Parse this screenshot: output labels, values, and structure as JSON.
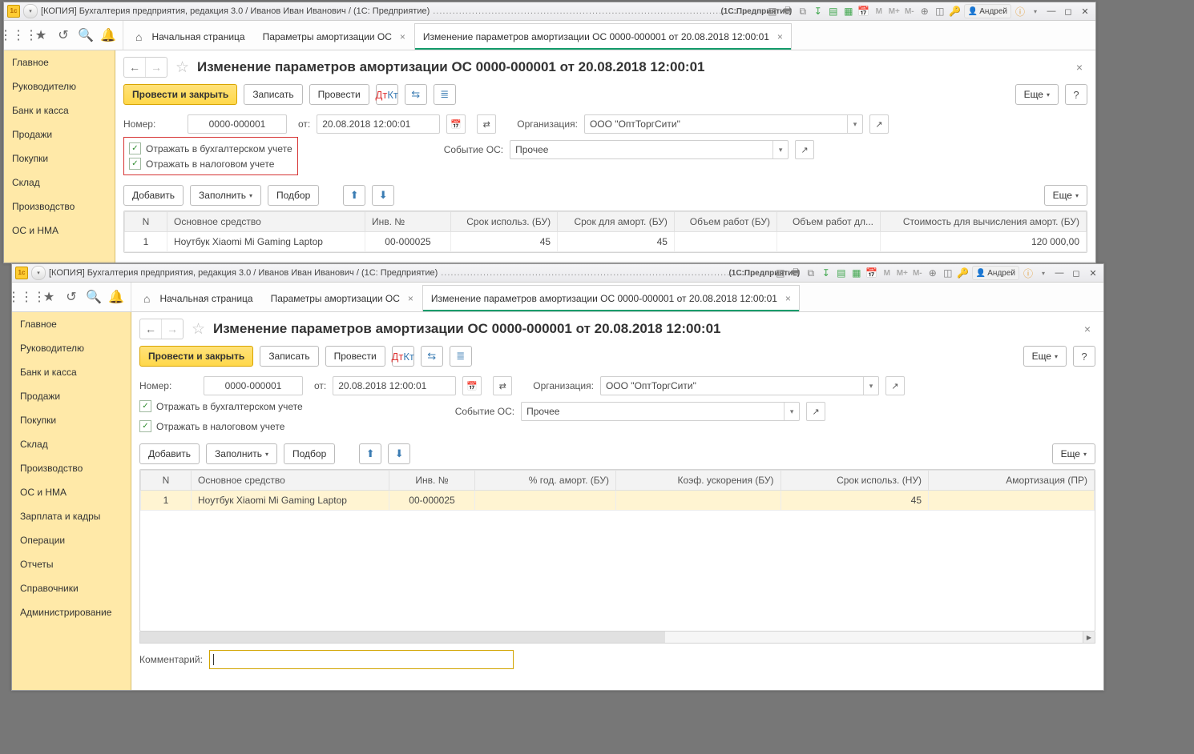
{
  "titlebar": {
    "title": "[КОПИЯ] Бухгалтерия предприятия, редакция 3.0 / Иванов Иван Иванович / (1С: Предприятие)",
    "product": "(1С:Предприятие)",
    "user": "Андрей"
  },
  "toolbar": {
    "tabs": {
      "home": "Начальная страница",
      "t1": "Параметры амортизации ОС",
      "t2": "Изменение параметров амортизации ОС 0000-000001 от 20.08.2018 12:00:01"
    }
  },
  "sidebar": {
    "items": [
      "Главное",
      "Руководителю",
      "Банк и касса",
      "Продажи",
      "Покупки",
      "Склад",
      "Производство",
      "ОС и НМА",
      "Зарплата и кадры",
      "Операции",
      "Отчеты",
      "Справочники",
      "Администрирование"
    ]
  },
  "page": {
    "title": "Изменение параметров амортизации ОС 0000-000001 от 20.08.2018 12:00:01"
  },
  "cmd": {
    "post_close": "Провести и закрыть",
    "write": "Записать",
    "post": "Провести",
    "more": "Еще",
    "help": "?",
    "add": "Добавить",
    "fill": "Заполнить",
    "select": "Подбор"
  },
  "form": {
    "number_label": "Номер:",
    "number": "0000-000001",
    "from_label": "от:",
    "date": "20.08.2018 12:00:01",
    "org_label": "Организация:",
    "org": "ООО \"ОптТоргСити\"",
    "event_label": "Событие ОС:",
    "event": "Прочее",
    "check_bu": "Отражать в бухгалтерском учете",
    "check_nu": "Отражать в налоговом учете"
  },
  "table1": {
    "headers": [
      "N",
      "Основное средство",
      "Инв. №",
      "Срок использ. (БУ)",
      "Срок для аморт. (БУ)",
      "Объем работ (БУ)",
      "Объем работ дл...",
      "Стоимость для вычисления аморт. (БУ)"
    ],
    "row": {
      "n": "1",
      "asset": "Ноутбук Xiaomi Mi Gaming Laptop",
      "inv": "00-000025",
      "term_bu": "45",
      "term_amort": "45",
      "vol1": "",
      "vol2": "",
      "cost": "120 000,00"
    }
  },
  "table2": {
    "headers": [
      "N",
      "Основное средство",
      "Инв. №",
      "% год. аморт. (БУ)",
      "Коэф. ускорения (БУ)",
      "Срок использ. (НУ)",
      "Амортизация (ПР)"
    ],
    "row": {
      "n": "1",
      "asset": "Ноутбук Xiaomi Mi Gaming Laptop",
      "inv": "00-000025",
      "pct": "",
      "coef": "",
      "term_nu": "45",
      "amort_pr": ""
    }
  },
  "comment": {
    "label": "Комментарий:"
  }
}
